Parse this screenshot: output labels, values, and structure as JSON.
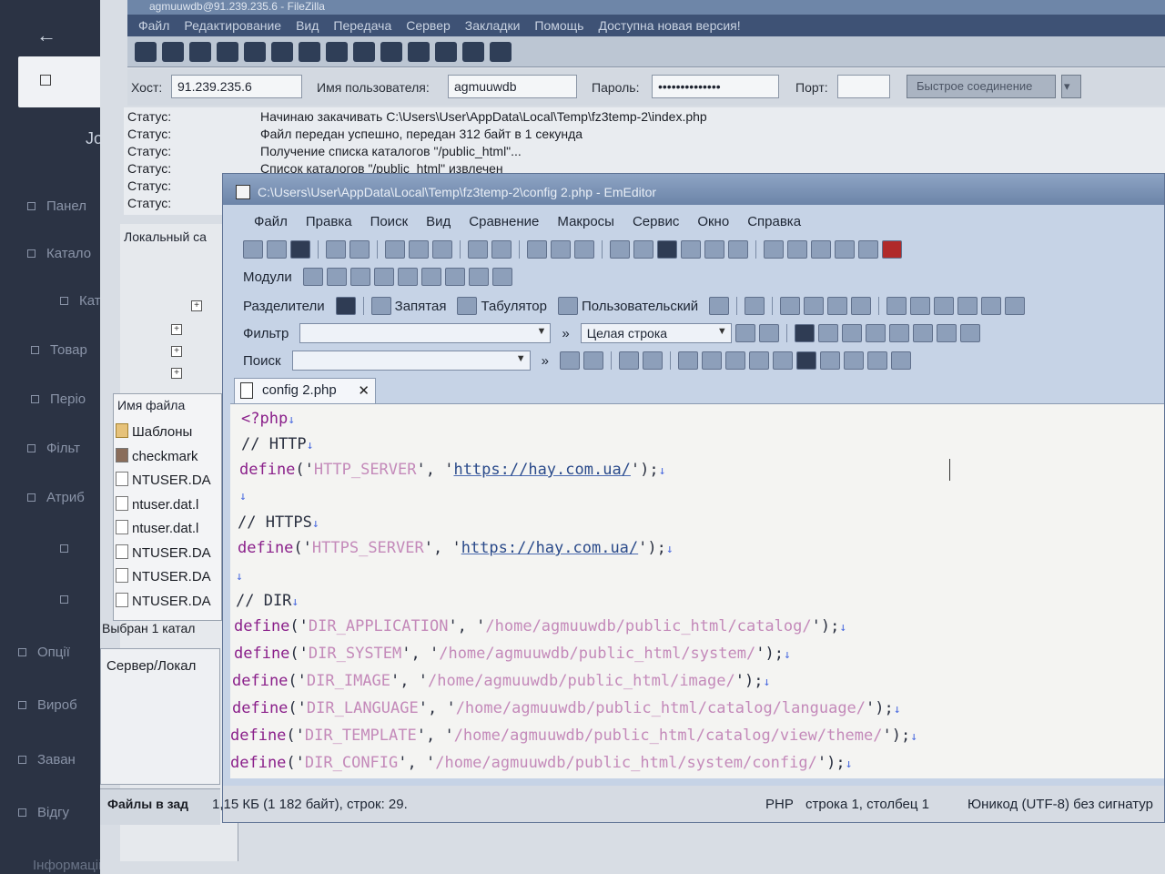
{
  "admin": {
    "user": "Joh",
    "menu": [
      "Панел",
      "Катало",
      "Катег",
      "Товар",
      "Періо",
      "Фільт",
      "Атриб",
      "",
      "",
      "Опції",
      "Вироб",
      "Заван",
      "Відгу"
    ],
    "footer": "Інформаційні сторінки"
  },
  "filezilla": {
    "title": "agmuuwdb@91.239.235.6 - FileZilla",
    "menu": [
      "Файл",
      "Редактирование",
      "Вид",
      "Передача",
      "Сервер",
      "Закладки",
      "Помощь",
      "Доступна новая версия!"
    ],
    "quick": {
      "host_label": "Хост:",
      "host_value": "91.239.235.6",
      "user_label": "Имя пользователя:",
      "user_value": "agmuuwdb",
      "pass_label": "Пароль:",
      "pass_value": "••••••••••••••",
      "port_label": "Порт:",
      "port_value": "",
      "connect_label": "Быстрое соединение"
    },
    "log": [
      {
        "k": "Статус:",
        "v": "Начинаю закачивать C:\\Users\\User\\AppData\\Local\\Temp\\fz3temp-2\\index.php"
      },
      {
        "k": "Статус:",
        "v": "Файл передан успешно, передан 312 байт в 1 секунда"
      },
      {
        "k": "Статус:",
        "v": "Получение списка каталогов \"/public_html\"..."
      },
      {
        "k": "Статус:",
        "v": "Список каталогов \"/public_html\" извлечен"
      },
      {
        "k": "Статус:",
        "v": ""
      },
      {
        "k": "Статус:",
        "v": ""
      }
    ],
    "local_site_label": "Локальный са",
    "files_header": "Имя файла",
    "files": [
      "Шаблоны",
      "checkmark",
      "NTUSER.DA",
      "ntuser.dat.l",
      "ntuser.dat.l",
      "NTUSER.DA",
      "NTUSER.DA",
      "NTUSER.DA"
    ],
    "selected_text": "Выбран 1 катал",
    "server_tab": "Сервер/Локал",
    "queue_tab": "Файлы в зад"
  },
  "emeditor": {
    "title": "C:\\Users\\User\\AppData\\Local\\Temp\\fz3temp-2\\config 2.php - EmEditor",
    "menu": [
      "Файл",
      "Правка",
      "Поиск",
      "Вид",
      "Сравнение",
      "Макросы",
      "Сервис",
      "Окно",
      "Справка"
    ],
    "modules_label": "Модули",
    "separators_label": "Разделители",
    "sep_comma": "Запятая",
    "sep_tab": "Табулятор",
    "sep_custom": "Пользовательский",
    "filter_label": "Фильтр",
    "filter_mode": "Целая строка",
    "search_label": "Поиск",
    "tab_name": "config 2.php",
    "code": [
      {
        "t": "open",
        "a": "<?php"
      },
      {
        "t": "comment",
        "a": "// HTTP"
      },
      {
        "t": "define",
        "a": "HTTP_SERVER",
        "b": "https://hay.com.ua/"
      },
      {
        "t": "blank"
      },
      {
        "t": "comment",
        "a": "// HTTPS"
      },
      {
        "t": "define",
        "a": "HTTPS_SERVER",
        "b": "https://hay.com.ua/"
      },
      {
        "t": "blank"
      },
      {
        "t": "comment",
        "a": "// DIR"
      },
      {
        "t": "define",
        "a": "DIR_APPLICATION",
        "b": "/home/agmuuwdb/public_html/catalog/"
      },
      {
        "t": "define",
        "a": "DIR_SYSTEM",
        "b": "/home/agmuuwdb/public_html/system/"
      },
      {
        "t": "define",
        "a": "DIR_IMAGE",
        "b": "/home/agmuuwdb/public_html/image/"
      },
      {
        "t": "define",
        "a": "DIR_LANGUAGE",
        "b": "/home/agmuuwdb/public_html/catalog/language/"
      },
      {
        "t": "define",
        "a": "DIR_TEMPLATE",
        "b": "/home/agmuuwdb/public_html/catalog/view/theme/"
      },
      {
        "t": "define",
        "a": "DIR_CONFIG",
        "b": "/home/agmuuwdb/public_html/system/config/"
      }
    ],
    "status": {
      "size": "1,15 КБ (1 182 байт), строк: 29.",
      "lang": "PHP",
      "pos": "строка 1, столбец 1",
      "enc": "Юникод (UTF-8) без сигнатур"
    }
  }
}
